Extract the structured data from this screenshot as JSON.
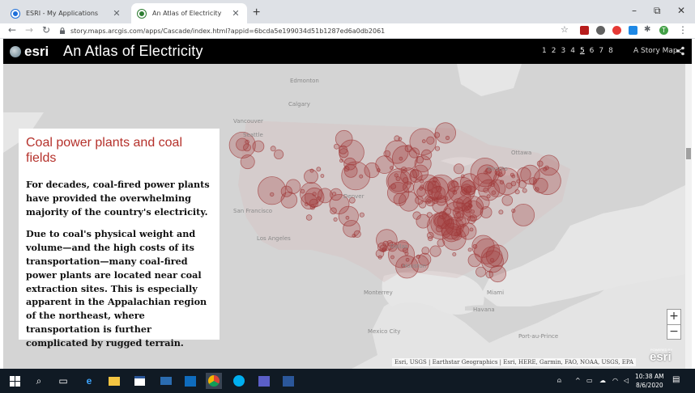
{
  "browser": {
    "tabs": [
      {
        "title": "ESRI - My Applications",
        "favicon_color": "#1e6fd9"
      },
      {
        "title": "An Atlas of Electricity",
        "favicon_color": "#2e7d32"
      }
    ],
    "new_tab_symbol": "+",
    "window_controls": [
      "–",
      "⧉",
      "✕"
    ],
    "url": "story.maps.arcgis.com/apps/Cascade/index.html?appid=6bcda5e199034d51b1287ed6a0db2061",
    "profile_initial": "T"
  },
  "story": {
    "logo_text": "esri",
    "title": "An Atlas of Electricity",
    "sections": [
      "1",
      "2",
      "3",
      "4",
      "5",
      "6",
      "7",
      "8"
    ],
    "current_section": "5",
    "storymap_link": "A Story Map",
    "share_icon": "share-icon"
  },
  "panel": {
    "heading": "Coal power plants and coal fields",
    "paragraph1": "For decades, coal-fired power plants have provided the overwhelming majority of the country's electricity.",
    "paragraph2": "Due to coal's physical weight and volume—and the high costs of its transportation—many coal-fired power plants are located near coal extraction sites. This is especially apparent in the Appalachian region of the northeast, where transportation is further complicated by rugged terrain."
  },
  "map": {
    "labels": {
      "edmonton": "Edmonton",
      "calgary": "Calgary",
      "vancouver": "Vancouver",
      "seattle": "Seattle",
      "ottawa": "Ottawa",
      "toronto": "Toronto",
      "denver": "Denver",
      "san_francisco": "San Francisco",
      "los_angeles": "Los Angeles",
      "dallas": "Dallas",
      "houston": "Houston",
      "monterrey": "Monterrey",
      "miami": "Miami",
      "havana": "Havana",
      "mexico_city": "Mexico City",
      "port_au_prince": "Port-au-Prince"
    },
    "zoom_in": "+",
    "zoom_out": "−",
    "attribution": "Esri, USGS | Earthstar Geographics | Esri, HERE, Garmin, FAO, NOAA, USGS, EPA",
    "powered_by": "POWERED BY",
    "esri_watermark": "esri",
    "marker_color": "#a03a3a"
  },
  "taskbar": {
    "time": "10:38 AM",
    "date": "8/6/2020",
    "pinned": [
      "search-icon",
      "task-view-icon",
      "edge-icon",
      "file-explorer-icon",
      "store-icon",
      "mail-icon",
      "outlook-icon",
      "chrome-icon",
      "skype-icon",
      "teams-icon",
      "word-icon"
    ]
  }
}
